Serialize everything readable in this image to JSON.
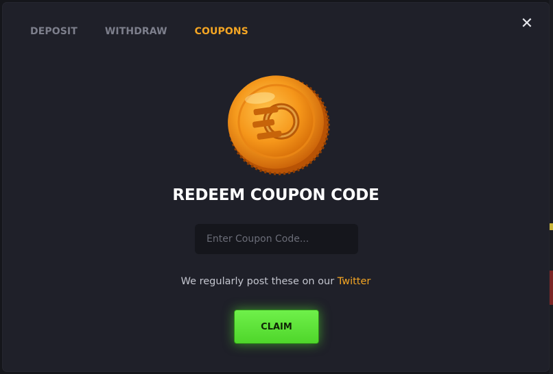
{
  "tabs": [
    {
      "label": "DEPOSIT",
      "active": false
    },
    {
      "label": "WITHDRAW",
      "active": false
    },
    {
      "label": "COUPONS",
      "active": true
    }
  ],
  "close_icon": "close-icon",
  "coin_icon": "coin-icon",
  "title": "REDEEM COUPON CODE",
  "coupon_input": {
    "value": "",
    "placeholder": "Enter Coupon Code..."
  },
  "note": {
    "prefix": "We regularly post these on our ",
    "link": "Twitter"
  },
  "claim_label": "CLAIM",
  "colors": {
    "accent": "#f5a623",
    "claim_button": "#5ce236",
    "modal_bg": "#1f2029",
    "input_bg": "#15161c"
  }
}
